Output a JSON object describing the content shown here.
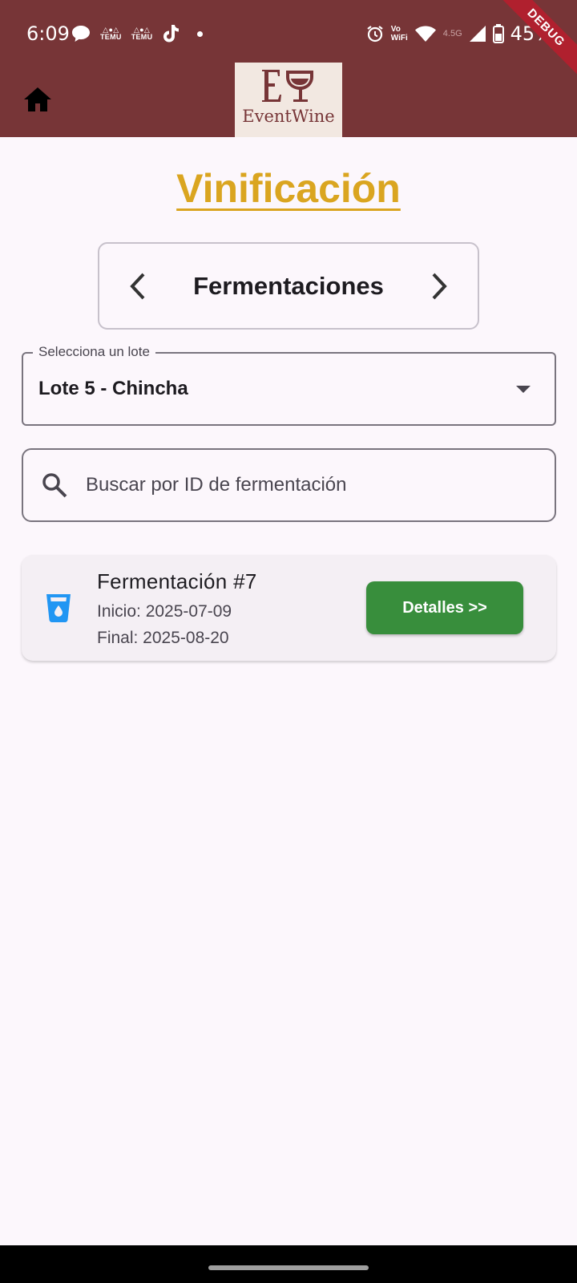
{
  "status_bar": {
    "time": "6:09",
    "notification_icons": [
      "chat-bubble-icon",
      "temu-icon",
      "temu-icon",
      "tiktok-icon",
      "more-dot-icon"
    ],
    "temu_label": "TEMU",
    "wifi_calling": "Vo\nWiFi",
    "network": "4.5G",
    "battery": "45%"
  },
  "debug_banner": "DEBUG",
  "app_bar": {
    "home_icon": "home-icon",
    "logo_text": "EventWine",
    "logo_mark": "EW"
  },
  "page": {
    "title": "Vinificación"
  },
  "section_switcher": {
    "label": "Fermentaciones",
    "prev_icon": "chevron-left-icon",
    "next_icon": "chevron-right-icon"
  },
  "lote_select": {
    "label": "Selecciona un lote",
    "value": "Lote 5 - Chincha"
  },
  "search": {
    "placeholder": "Buscar por ID de fermentación",
    "value": ""
  },
  "fermentations": [
    {
      "title": "Fermentación #7",
      "start": "Inicio: 2025-07-09",
      "end": "Final: 2025-08-20",
      "button_label": "Detalles >>",
      "icon": "water-glass-icon"
    }
  ],
  "colors": {
    "app_bar": "#773537",
    "title": "#daa520",
    "button": "#388e3c",
    "card_icon": "#2196f3"
  }
}
